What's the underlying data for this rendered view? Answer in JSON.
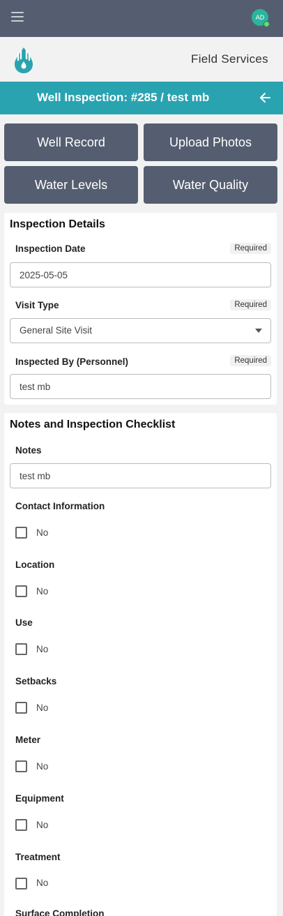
{
  "topbar": {
    "avatar_initials": "AD",
    "avatar_color": "#2bb59d"
  },
  "brand": {
    "title": "Field Services",
    "logo_color": "#2aa3b1"
  },
  "header": {
    "title": "Well Inspection: #285 / test mb"
  },
  "nav_buttons": [
    {
      "label": "Well Record"
    },
    {
      "label": "Upload Photos"
    },
    {
      "label": "Water Levels"
    },
    {
      "label": "Water Quality"
    }
  ],
  "inspection_details": {
    "title": "Inspection Details",
    "date_label": "Inspection Date",
    "date_value": "2025-05-05",
    "visit_type_label": "Visit Type",
    "visit_type_value": "General Site Visit",
    "inspected_by_label": "Inspected By (Personnel)",
    "inspected_by_value": "test mb",
    "required_label": "Required"
  },
  "checklist": {
    "title": "Notes and Inspection Checklist",
    "notes_label": "Notes",
    "notes_value": "test mb",
    "items": [
      {
        "label": "Contact Information",
        "value": "No"
      },
      {
        "label": "Location",
        "value": "No"
      },
      {
        "label": "Use",
        "value": "No"
      },
      {
        "label": "Setbacks",
        "value": "No"
      },
      {
        "label": "Meter",
        "value": "No"
      },
      {
        "label": "Equipment",
        "value": "No"
      },
      {
        "label": "Treatment",
        "value": "No"
      },
      {
        "label": "Surface Completion",
        "value": ""
      }
    ]
  }
}
